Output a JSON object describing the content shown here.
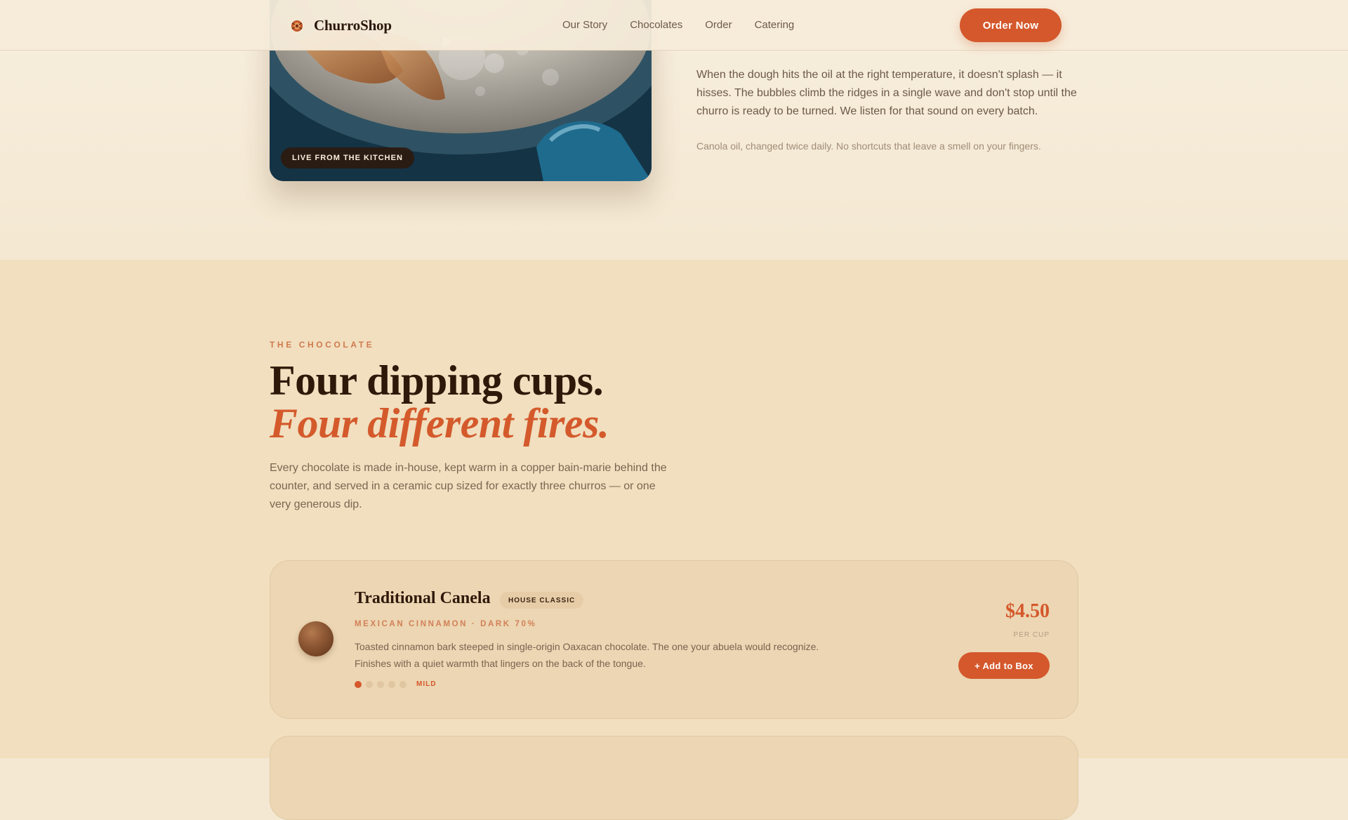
{
  "header": {
    "brand": "ChurroShop",
    "nav": [
      {
        "label": "Our Story"
      },
      {
        "label": "Chocolates"
      },
      {
        "label": "Order"
      },
      {
        "label": "Catering"
      }
    ],
    "cta_label": "Order Now",
    "logo_icon": "churro-logo-icon"
  },
  "video": {
    "badge": "LIVE FROM THE KITCHEN",
    "play_icon": "play-icon"
  },
  "frying": {
    "paragraph": "When the dough hits the oil at the right temperature, it doesn't splash — it hisses. The bubbles climb the ridges in a single wave and don't stop until the churro is ready to be turned. We listen for that sound on every batch.",
    "note": "Canola oil, changed twice daily. No shortcuts that leave a smell on your fingers."
  },
  "chocolate": {
    "eyebrow": "THE CHOCOLATE",
    "headline_line1": "Four dipping cups.",
    "headline_line2": "Four different fires.",
    "intro": "Every chocolate is made in-house, kept warm in a copper bain-marie behind the counter, and served in a ceramic cup sized for exactly three churros — or one very generous dip.",
    "products": [
      {
        "name": "Traditional Canela",
        "badge": "HOUSE CLASSIC",
        "origin": "MEXICAN CINNAMON · DARK 70%",
        "description": "Toasted cinnamon bark steeped in single-origin Oaxacan chocolate. The one your abuela would recognize. Finishes with a quiet warmth that lingers on the back of the tongue.",
        "heat_level": 1,
        "heat_max": 5,
        "heat_label": "MILD",
        "price": "$4.50",
        "price_unit": "PER CUP",
        "add_label": "+ Add to Box"
      }
    ]
  },
  "colors": {
    "accent": "#d4582c",
    "dark": "#2e1809",
    "section_bg": "#f1dfbf",
    "card_bg": "#ecd6b3"
  }
}
